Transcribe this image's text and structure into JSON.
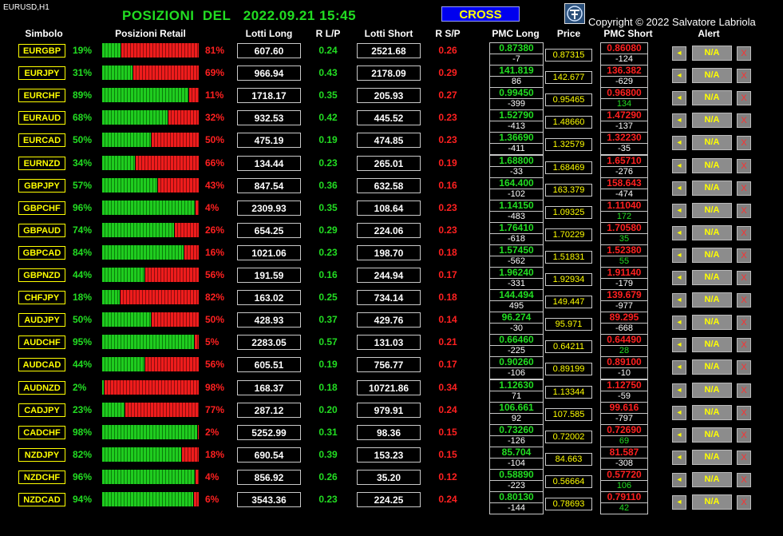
{
  "chart_symbol": "EURUSD,H1",
  "title": "POSIZIONI  DEL   2022.09.21 15:45",
  "cross_label": "CROSS",
  "copyright": "Copyright © 2022 Salvatore Labriola",
  "colors": {
    "long": "#22dd22",
    "short": "#ff2020",
    "accent": "#ffff00",
    "cross_bg": "#0000ee"
  },
  "headers": {
    "simbolo": "Simbolo",
    "posizioni": "Posizioni Retail",
    "lotti_long": "Lotti Long",
    "rlp": "R L/P",
    "lotti_short": "Lotti Short",
    "rsp": "R S/P",
    "pmc_long": "PMC Long",
    "price": "Price",
    "pmc_short": "PMC Short",
    "alert": "Alert"
  },
  "alert_na": "N/A",
  "alert_close": "X",
  "bell_glyph": "◂",
  "rows": [
    {
      "symbol": "EURGBP",
      "long_pct": "19%",
      "short_pct": "81%",
      "lotti_long": "607.60",
      "rlp": "0.24",
      "lotti_short": "2521.68",
      "rsp": "0.26",
      "pmc_long": "0.87380",
      "pmc_long_pips": "-7",
      "price": "0.87315",
      "pmc_short": "0.86080",
      "pmc_short_pips": "-124"
    },
    {
      "symbol": "EURJPY",
      "long_pct": "31%",
      "short_pct": "69%",
      "lotti_long": "966.94",
      "rlp": "0.43",
      "lotti_short": "2178.09",
      "rsp": "0.29",
      "pmc_long": "141.819",
      "pmc_long_pips": "86",
      "price": "142.677",
      "pmc_short": "136.382",
      "pmc_short_pips": "-629"
    },
    {
      "symbol": "EURCHF",
      "long_pct": "89%",
      "short_pct": "11%",
      "lotti_long": "1718.17",
      "rlp": "0.35",
      "lotti_short": "205.93",
      "rsp": "0.27",
      "pmc_long": "0.99450",
      "pmc_long_pips": "-399",
      "price": "0.95465",
      "pmc_short": "0.96800",
      "pmc_short_pips": "134"
    },
    {
      "symbol": "EURAUD",
      "long_pct": "68%",
      "short_pct": "32%",
      "lotti_long": "932.53",
      "rlp": "0.42",
      "lotti_short": "445.52",
      "rsp": "0.23",
      "pmc_long": "1.52790",
      "pmc_long_pips": "-413",
      "price": "1.48660",
      "pmc_short": "1.47290",
      "pmc_short_pips": "-137"
    },
    {
      "symbol": "EURCAD",
      "long_pct": "50%",
      "short_pct": "50%",
      "lotti_long": "475.19",
      "rlp": "0.19",
      "lotti_short": "474.85",
      "rsp": "0.23",
      "pmc_long": "1.36690",
      "pmc_long_pips": "-411",
      "price": "1.32579",
      "pmc_short": "1.32230",
      "pmc_short_pips": "-35"
    },
    {
      "symbol": "EURNZD",
      "long_pct": "34%",
      "short_pct": "66%",
      "lotti_long": "134.44",
      "rlp": "0.23",
      "lotti_short": "265.01",
      "rsp": "0.19",
      "pmc_long": "1.68800",
      "pmc_long_pips": "-33",
      "price": "1.68469",
      "pmc_short": "1.65710",
      "pmc_short_pips": "-276"
    },
    {
      "symbol": "GBPJPY",
      "long_pct": "57%",
      "short_pct": "43%",
      "lotti_long": "847.54",
      "rlp": "0.36",
      "lotti_short": "632.58",
      "rsp": "0.16",
      "pmc_long": "164.400",
      "pmc_long_pips": "-102",
      "price": "163.379",
      "pmc_short": "158.643",
      "pmc_short_pips": "-474"
    },
    {
      "symbol": "GBPCHF",
      "long_pct": "96%",
      "short_pct": "4%",
      "lotti_long": "2309.93",
      "rlp": "0.35",
      "lotti_short": "108.64",
      "rsp": "0.23",
      "pmc_long": "1.14150",
      "pmc_long_pips": "-483",
      "price": "1.09325",
      "pmc_short": "1.11040",
      "pmc_short_pips": "172"
    },
    {
      "symbol": "GBPAUD",
      "long_pct": "74%",
      "short_pct": "26%",
      "lotti_long": "654.25",
      "rlp": "0.29",
      "lotti_short": "224.06",
      "rsp": "0.23",
      "pmc_long": "1.76410",
      "pmc_long_pips": "-618",
      "price": "1.70229",
      "pmc_short": "1.70580",
      "pmc_short_pips": "35"
    },
    {
      "symbol": "GBPCAD",
      "long_pct": "84%",
      "short_pct": "16%",
      "lotti_long": "1021.06",
      "rlp": "0.23",
      "lotti_short": "198.70",
      "rsp": "0.18",
      "pmc_long": "1.57450",
      "pmc_long_pips": "-562",
      "price": "1.51831",
      "pmc_short": "1.52380",
      "pmc_short_pips": "55"
    },
    {
      "symbol": "GBPNZD",
      "long_pct": "44%",
      "short_pct": "56%",
      "lotti_long": "191.59",
      "rlp": "0.16",
      "lotti_short": "244.94",
      "rsp": "0.17",
      "pmc_long": "1.96240",
      "pmc_long_pips": "-331",
      "price": "1.92934",
      "pmc_short": "1.91140",
      "pmc_short_pips": "-179"
    },
    {
      "symbol": "CHFJPY",
      "long_pct": "18%",
      "short_pct": "82%",
      "lotti_long": "163.02",
      "rlp": "0.25",
      "lotti_short": "734.14",
      "rsp": "0.18",
      "pmc_long": "144.494",
      "pmc_long_pips": "495",
      "price": "149.447",
      "pmc_short": "139.679",
      "pmc_short_pips": "-977"
    },
    {
      "symbol": "AUDJPY",
      "long_pct": "50%",
      "short_pct": "50%",
      "lotti_long": "428.93",
      "rlp": "0.37",
      "lotti_short": "429.76",
      "rsp": "0.14",
      "pmc_long": "96.274",
      "pmc_long_pips": "-30",
      "price": "95.971",
      "pmc_short": "89.295",
      "pmc_short_pips": "-668"
    },
    {
      "symbol": "AUDCHF",
      "long_pct": "95%",
      "short_pct": "5%",
      "lotti_long": "2283.05",
      "rlp": "0.57",
      "lotti_short": "131.03",
      "rsp": "0.21",
      "pmc_long": "0.66460",
      "pmc_long_pips": "-225",
      "price": "0.64211",
      "pmc_short": "0.64490",
      "pmc_short_pips": "28"
    },
    {
      "symbol": "AUDCAD",
      "long_pct": "44%",
      "short_pct": "56%",
      "lotti_long": "605.51",
      "rlp": "0.19",
      "lotti_short": "756.77",
      "rsp": "0.17",
      "pmc_long": "0.90260",
      "pmc_long_pips": "-106",
      "price": "0.89199",
      "pmc_short": "0.89100",
      "pmc_short_pips": "-10"
    },
    {
      "symbol": "AUDNZD",
      "long_pct": "2%",
      "short_pct": "98%",
      "lotti_long": "168.37",
      "rlp": "0.18",
      "lotti_short": "10721.86",
      "rsp": "0.34",
      "pmc_long": "1.12630",
      "pmc_long_pips": "71",
      "price": "1.13344",
      "pmc_short": "1.12750",
      "pmc_short_pips": "-59"
    },
    {
      "symbol": "CADJPY",
      "long_pct": "23%",
      "short_pct": "77%",
      "lotti_long": "287.12",
      "rlp": "0.20",
      "lotti_short": "979.91",
      "rsp": "0.24",
      "pmc_long": "106.661",
      "pmc_long_pips": "92",
      "price": "107.585",
      "pmc_short": "99.616",
      "pmc_short_pips": "-797"
    },
    {
      "symbol": "CADCHF",
      "long_pct": "98%",
      "short_pct": "2%",
      "lotti_long": "5252.99",
      "rlp": "0.31",
      "lotti_short": "98.36",
      "rsp": "0.15",
      "pmc_long": "0.73260",
      "pmc_long_pips": "-126",
      "price": "0.72002",
      "pmc_short": "0.72690",
      "pmc_short_pips": "69"
    },
    {
      "symbol": "NZDJPY",
      "long_pct": "82%",
      "short_pct": "18%",
      "lotti_long": "690.54",
      "rlp": "0.39",
      "lotti_short": "153.23",
      "rsp": "0.15",
      "pmc_long": "85.704",
      "pmc_long_pips": "-104",
      "price": "84.663",
      "pmc_short": "81.587",
      "pmc_short_pips": "-308"
    },
    {
      "symbol": "NZDCHF",
      "long_pct": "96%",
      "short_pct": "4%",
      "lotti_long": "856.92",
      "rlp": "0.26",
      "lotti_short": "35.20",
      "rsp": "0.12",
      "pmc_long": "0.58890",
      "pmc_long_pips": "-223",
      "price": "0.56664",
      "pmc_short": "0.57720",
      "pmc_short_pips": "106"
    },
    {
      "symbol": "NZDCAD",
      "long_pct": "94%",
      "short_pct": "6%",
      "lotti_long": "3543.36",
      "rlp": "0.23",
      "lotti_short": "224.25",
      "rsp": "0.24",
      "pmc_long": "0.80130",
      "pmc_long_pips": "-144",
      "price": "0.78693",
      "pmc_short": "0.79110",
      "pmc_short_pips": "42"
    }
  ]
}
